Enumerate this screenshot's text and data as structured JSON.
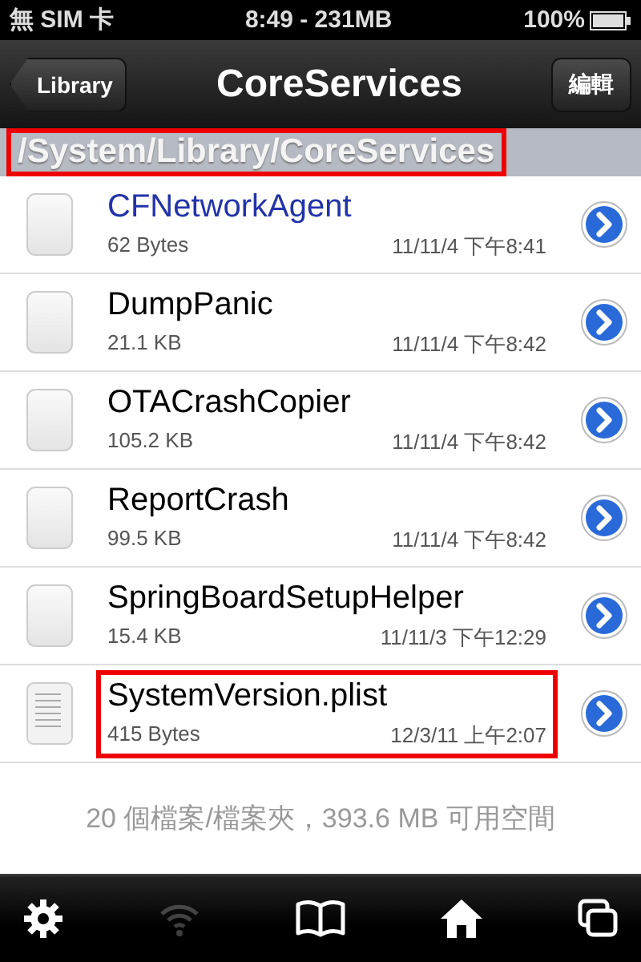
{
  "status_bar": {
    "carrier": "無 SIM 卡",
    "center": "8:49 - 231MB",
    "battery_text": "100%"
  },
  "nav_bar": {
    "back": "Library",
    "title": "CoreServices",
    "edit": "編輯"
  },
  "path_bar": {
    "text": "/System/Library/CoreServices",
    "highlighted": true
  },
  "files": [
    {
      "name": "CFNetworkAgent",
      "size": "62 Bytes",
      "date": "11/11/4 下午8:41",
      "kind": "blank",
      "color": "#2233aa",
      "highlighted": false
    },
    {
      "name": "DumpPanic",
      "size": "21.1 KB",
      "date": "11/11/4 下午8:42",
      "kind": "blank",
      "color": "#000000",
      "highlighted": false
    },
    {
      "name": "OTACrashCopier",
      "size": "105.2 KB",
      "date": "11/11/4 下午8:42",
      "kind": "blank",
      "color": "#000000",
      "highlighted": false
    },
    {
      "name": "ReportCrash",
      "size": "99.5 KB",
      "date": "11/11/4 下午8:42",
      "kind": "blank",
      "color": "#000000",
      "highlighted": false
    },
    {
      "name": "SpringBoardSetupHelper",
      "size": "15.4 KB",
      "date": "11/11/3 下午12:29",
      "kind": "blank",
      "color": "#000000",
      "highlighted": false
    },
    {
      "name": "SystemVersion.plist",
      "size": "415 Bytes",
      "date": "12/3/11 上午2:07",
      "kind": "text",
      "color": "#000000",
      "highlighted": true
    }
  ],
  "footer": "20 個檔案/檔案夾，393.6 MB 可用空間",
  "toolbar": [
    {
      "kind": "settings",
      "disabled": false
    },
    {
      "kind": "wifi",
      "disabled": true
    },
    {
      "kind": "bookmarks",
      "disabled": false
    },
    {
      "kind": "home",
      "disabled": false
    },
    {
      "kind": "windows",
      "disabled": false
    }
  ]
}
